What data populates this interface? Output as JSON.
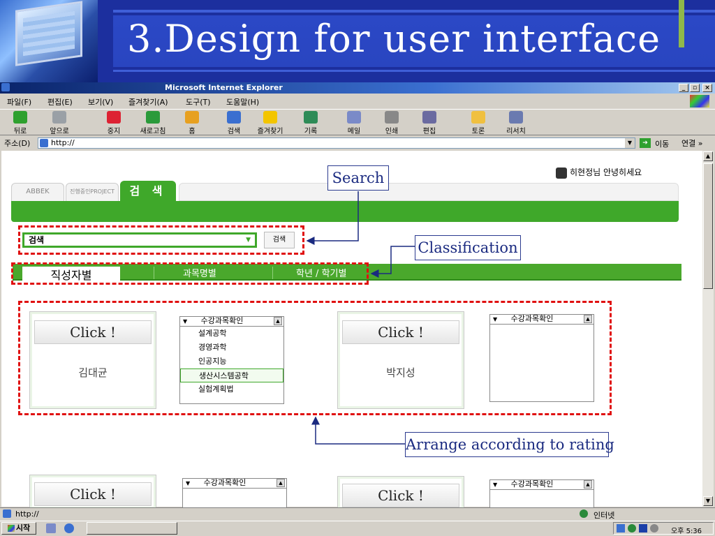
{
  "slide": {
    "title": "3.Design for user interface"
  },
  "window": {
    "title": "Microsoft Internet Explorer",
    "min": "_",
    "max": "▫",
    "close": "×"
  },
  "menu": [
    "파일(F)",
    "편집(E)",
    "보기(V)",
    "즐겨찾기(A)",
    "도구(T)",
    "도움말(H)"
  ],
  "toolbar": [
    {
      "label": "뒤로",
      "icon": "back-icon",
      "color": "#2ea02e"
    },
    {
      "label": "앞으로",
      "icon": "forward-icon",
      "color": "#9aa0a6"
    },
    {
      "label": "중지",
      "icon": "stop-icon",
      "color": "#d23"
    },
    {
      "label": "새로고침",
      "icon": "refresh-icon",
      "color": "#2a9a3a"
    },
    {
      "label": "홈",
      "icon": "home-icon",
      "color": "#e7a020"
    },
    {
      "label": "검색",
      "icon": "search-icon",
      "color": "#3a6fd0"
    },
    {
      "label": "즐겨찾기",
      "icon": "favorites-icon",
      "color": "#f3c500"
    },
    {
      "label": "기록",
      "icon": "history-icon",
      "color": "#2e8b57"
    },
    {
      "label": "메일",
      "icon": "mail-icon",
      "color": "#7a8ac8"
    },
    {
      "label": "인쇄",
      "icon": "print-icon",
      "color": "#888"
    },
    {
      "label": "편집",
      "icon": "edit-icon",
      "color": "#6a6aa0"
    },
    {
      "label": "토론",
      "icon": "discuss-icon",
      "color": "#f0c040"
    },
    {
      "label": "리서치",
      "icon": "research-icon",
      "color": "#6a7ab0"
    }
  ],
  "address": {
    "label": "주소(D)",
    "value": "http://",
    "go": "이동",
    "links": "연결 »"
  },
  "page": {
    "greeting": "히현정님 안녕히세요",
    "tabs": [
      "ABBEK",
      "진행중인PROJECT",
      "검 색"
    ],
    "search_select": "검색",
    "search_button": "검색",
    "class_tabs": [
      "직성자별",
      "과목명별",
      "학년 / 학기별"
    ],
    "cards": [
      {
        "button": "Click !",
        "name": "김대균"
      },
      {
        "button": "Click !",
        "name": "박지성"
      },
      {
        "button": "Click !",
        "name": ""
      },
      {
        "button": "Click !",
        "name": ""
      }
    ],
    "listboxes": [
      {
        "header": "수강과목확인",
        "items": [
          "설계공학",
          "경영과학",
          "인공지능",
          "생산시스템공학",
          "실험계획법"
        ],
        "selected": 3
      },
      {
        "header": "수강과목확인",
        "items": []
      },
      {
        "header": "수강과목확인",
        "items": []
      },
      {
        "header": "수강과목확인",
        "items": []
      }
    ]
  },
  "callouts": {
    "search": "Search",
    "classification": "Classification",
    "rating": "Arrange according to rating"
  },
  "status": {
    "url": "http://",
    "zone": "인터넷"
  },
  "taskbar": {
    "start": "시작",
    "clock": "오후 5:36"
  },
  "colors": {
    "green": "#3fa82a",
    "highlight": "#e01010",
    "callout_border": "#2b3a8f"
  }
}
